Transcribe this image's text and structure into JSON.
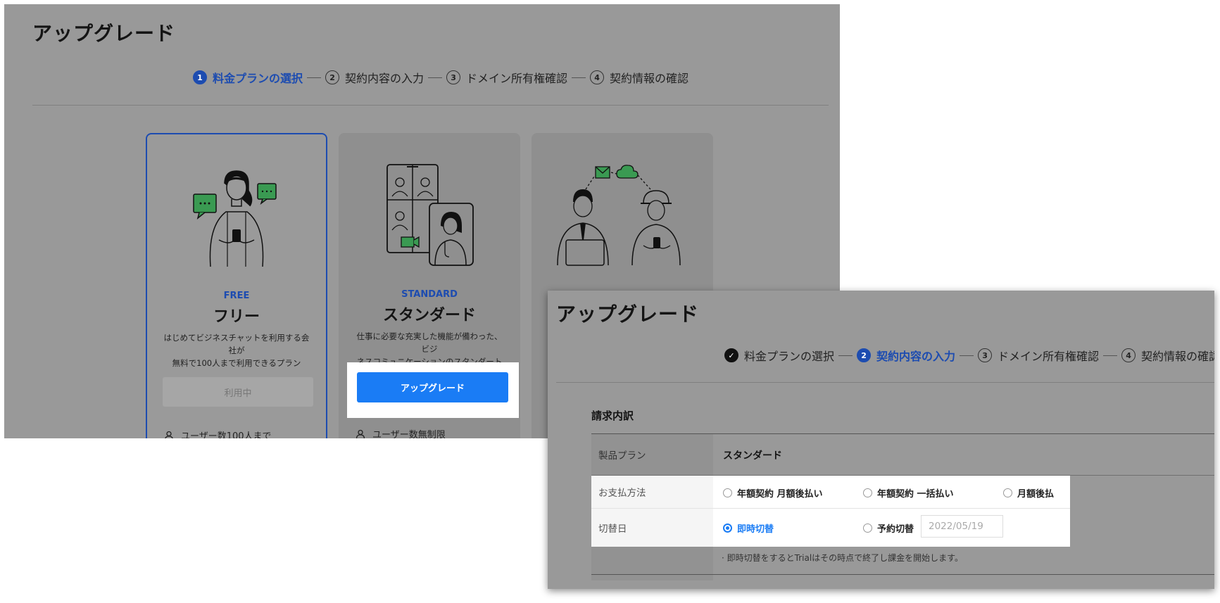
{
  "panel1": {
    "title": "アップグレード",
    "steps": [
      {
        "num": "1",
        "label": "料金プランの選択",
        "state": "active"
      },
      {
        "num": "2",
        "label": "契約内容の入力",
        "state": "pending"
      },
      {
        "num": "3",
        "label": "ドメイン所有権確認",
        "state": "pending"
      },
      {
        "num": "4",
        "label": "契約情報の確認",
        "state": "pending"
      }
    ],
    "plans": [
      {
        "code": "FREE",
        "name": "フリー",
        "desc_line1": "はじめてビジネスチャットを利用する会社が",
        "desc_line2": "無料で100人まで利用できるプラン",
        "button": "利用中",
        "feature": "ユーザー数100人まで"
      },
      {
        "code": "STANDARD",
        "name": "スタンダード",
        "desc_line1": "仕事に必要な充実した機能が備わった、ビジ",
        "desc_line2": "ネスコミュニケーションのスタンダート",
        "button": "アップグレード",
        "feature": "ユーザー数無制限"
      }
    ]
  },
  "panel2": {
    "title": "アップグレード",
    "steps": [
      {
        "num": "✓",
        "label": "料金プランの選択",
        "state": "done"
      },
      {
        "num": "2",
        "label": "契約内容の入力",
        "state": "active"
      },
      {
        "num": "3",
        "label": "ドメイン所有権確認",
        "state": "pending"
      },
      {
        "num": "4",
        "label": "契約情報の確認",
        "state": "pending"
      }
    ],
    "section_title": "請求内訳",
    "rows": {
      "plan": {
        "label": "製品プラン",
        "value": "スタンダード"
      },
      "payment": {
        "label": "お支払方法",
        "options": [
          "年額契約 月額後払い",
          "年額契約 一括払い",
          "月額後払"
        ],
        "selected": null
      },
      "switch": {
        "label": "切替日",
        "options": [
          "即時切替",
          "予約切替"
        ],
        "selected": "即時切替",
        "date_placeholder": "2022/05/19"
      }
    },
    "note": "· 即時切替をするとTrialはその時点で終了し課金を開始します。"
  },
  "colors": {
    "accent_blue": "#1d4cb0",
    "button_blue": "#1a7cf5",
    "illustration_green": "#3a9a52",
    "overlay_gray": "#999999"
  }
}
